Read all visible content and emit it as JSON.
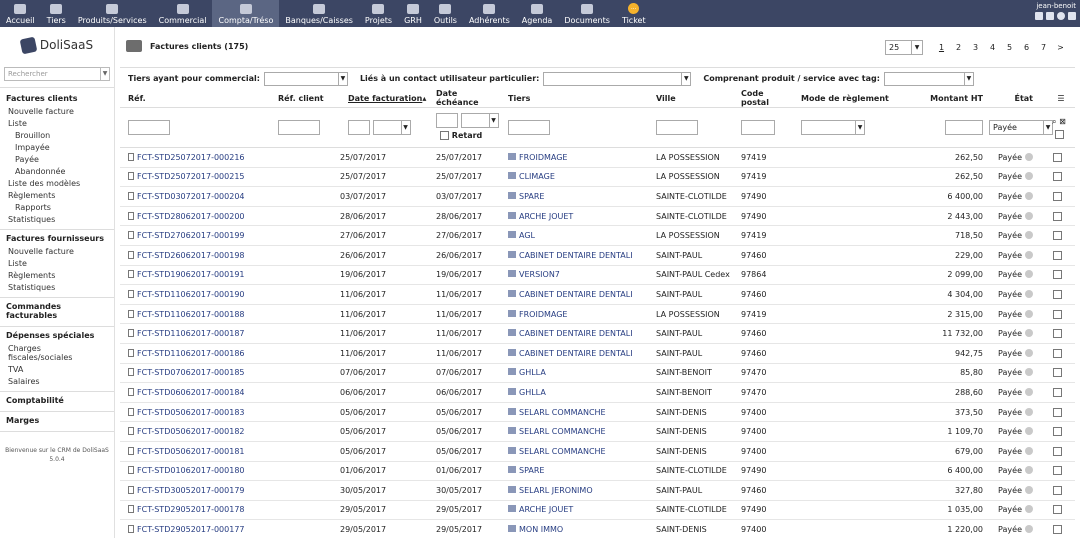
{
  "topnav": [
    {
      "label": "Accueil",
      "icon": "home-icon"
    },
    {
      "label": "Tiers",
      "icon": "company-icon"
    },
    {
      "label": "Produits/Services",
      "icon": "products-icon"
    },
    {
      "label": "Commercial",
      "icon": "commercial-icon"
    },
    {
      "label": "Compta/Tréso",
      "icon": "accounting-icon",
      "active": true
    },
    {
      "label": "Banques/Caisses",
      "icon": "bank-icon"
    },
    {
      "label": "Projets",
      "icon": "projects-icon"
    },
    {
      "label": "GRH",
      "icon": "hr-icon"
    },
    {
      "label": "Outils",
      "icon": "tools-icon"
    },
    {
      "label": "Adhérents",
      "icon": "members-icon"
    },
    {
      "label": "Agenda",
      "icon": "agenda-icon"
    },
    {
      "label": "Documents",
      "icon": "documents-icon"
    },
    {
      "label": "Ticket",
      "icon": "ticket-icon",
      "badge": "..."
    }
  ],
  "user": {
    "name": "jean-benoit"
  },
  "logo": {
    "text": "DoliSaaS"
  },
  "search": {
    "placeholder": "Rechercher"
  },
  "menu": [
    {
      "title": "Factures clients",
      "items": [
        {
          "label": "Nouvelle facture",
          "level": 1
        },
        {
          "label": "Liste",
          "level": 1
        },
        {
          "label": "Brouillon",
          "level": 2
        },
        {
          "label": "Impayée",
          "level": 2
        },
        {
          "label": "Payée",
          "level": 2
        },
        {
          "label": "Abandonnée",
          "level": 2
        },
        {
          "label": "Liste des modèles",
          "level": 1
        },
        {
          "label": "Règlements",
          "level": 1
        },
        {
          "label": "Rapports",
          "level": 2
        },
        {
          "label": "Statistiques",
          "level": 1
        }
      ]
    },
    {
      "title": "Factures fournisseurs",
      "items": [
        {
          "label": "Nouvelle facture",
          "level": 1
        },
        {
          "label": "Liste",
          "level": 1
        },
        {
          "label": "Règlements",
          "level": 1
        },
        {
          "label": "Statistiques",
          "level": 1
        }
      ]
    },
    {
      "title": "Commandes facturables",
      "items": []
    },
    {
      "title": "Dépenses spéciales",
      "items": [
        {
          "label": "Charges fiscales/sociales",
          "level": 1
        },
        {
          "label": "TVA",
          "level": 1
        },
        {
          "label": "Salaires",
          "level": 1
        }
      ]
    },
    {
      "title": "Comptabilité",
      "items": []
    },
    {
      "title": "Marges",
      "items": []
    }
  ],
  "footer": {
    "line1": "Bienvenue sur le CRM de DoliSaaS",
    "line2": "5.0.4"
  },
  "page": {
    "title": "Factures clients (175)"
  },
  "pager": {
    "per_page": "25",
    "pages": [
      "1",
      "2",
      "3",
      "4",
      "5",
      "6",
      "7"
    ],
    "next": ">",
    "current": "1"
  },
  "filters": {
    "commercial_label": "Tiers ayant pour commercial:",
    "contact_label": "Liés à un contact utilisateur particulier:",
    "tag_label": "Comprenant produit / service avec tag:",
    "retard_label": "Retard",
    "etat_value": "Payée"
  },
  "columns": {
    "ref": "Réf.",
    "ref_client": "Réf. client",
    "date_fact": "Date facturation",
    "date_ech": "Date échéance",
    "tiers": "Tiers",
    "ville": "Ville",
    "cp": "Code postal",
    "mode": "Mode de règlement",
    "montant": "Montant HT",
    "etat": "État"
  },
  "rows": [
    {
      "ref": "FCT-STD25072017-000216",
      "date": "25/07/2017",
      "due": "25/07/2017",
      "tiers": "FROIDMAGE",
      "ville": "LA POSSESSION",
      "cp": "97419",
      "montant": "262,50",
      "etat": "Payée"
    },
    {
      "ref": "FCT-STD25072017-000215",
      "date": "25/07/2017",
      "due": "25/07/2017",
      "tiers": "CLIMAGE",
      "ville": "LA POSSESSION",
      "cp": "97419",
      "montant": "262,50",
      "etat": "Payée"
    },
    {
      "ref": "FCT-STD03072017-000204",
      "date": "03/07/2017",
      "due": "03/07/2017",
      "tiers": "SPARE",
      "ville": "SAINTE-CLOTILDE",
      "cp": "97490",
      "montant": "6 400,00",
      "etat": "Payée"
    },
    {
      "ref": "FCT-STD28062017-000200",
      "date": "28/06/2017",
      "due": "28/06/2017",
      "tiers": "ARCHE JOUET",
      "ville": "SAINTE-CLOTILDE",
      "cp": "97490",
      "montant": "2 443,00",
      "etat": "Payée"
    },
    {
      "ref": "FCT-STD27062017-000199",
      "date": "27/06/2017",
      "due": "27/06/2017",
      "tiers": "AGL",
      "ville": "LA POSSESSION",
      "cp": "97419",
      "montant": "718,50",
      "etat": "Payée"
    },
    {
      "ref": "FCT-STD26062017-000198",
      "date": "26/06/2017",
      "due": "26/06/2017",
      "tiers": "CABINET DENTAIRE DENTALI",
      "ville": "SAINT-PAUL",
      "cp": "97460",
      "montant": "229,00",
      "etat": "Payée"
    },
    {
      "ref": "FCT-STD19062017-000191",
      "date": "19/06/2017",
      "due": "19/06/2017",
      "tiers": "VERSION7",
      "ville": "SAINT-PAUL Cedex",
      "cp": "97864",
      "montant": "2 099,00",
      "etat": "Payée"
    },
    {
      "ref": "FCT-STD11062017-000190",
      "date": "11/06/2017",
      "due": "11/06/2017",
      "tiers": "CABINET DENTAIRE DENTALI",
      "ville": "SAINT-PAUL",
      "cp": "97460",
      "montant": "4 304,00",
      "etat": "Payée"
    },
    {
      "ref": "FCT-STD11062017-000188",
      "date": "11/06/2017",
      "due": "11/06/2017",
      "tiers": "FROIDMAGE",
      "ville": "LA POSSESSION",
      "cp": "97419",
      "montant": "2 315,00",
      "etat": "Payée"
    },
    {
      "ref": "FCT-STD11062017-000187",
      "date": "11/06/2017",
      "due": "11/06/2017",
      "tiers": "CABINET DENTAIRE DENTALI",
      "ville": "SAINT-PAUL",
      "cp": "97460",
      "montant": "11 732,00",
      "etat": "Payée"
    },
    {
      "ref": "FCT-STD11062017-000186",
      "date": "11/06/2017",
      "due": "11/06/2017",
      "tiers": "CABINET DENTAIRE DENTALI",
      "ville": "SAINT-PAUL",
      "cp": "97460",
      "montant": "942,75",
      "etat": "Payée"
    },
    {
      "ref": "FCT-STD07062017-000185",
      "date": "07/06/2017",
      "due": "07/06/2017",
      "tiers": "GHLLA",
      "ville": "SAINT-BENOIT",
      "cp": "97470",
      "montant": "85,80",
      "etat": "Payée"
    },
    {
      "ref": "FCT-STD06062017-000184",
      "date": "06/06/2017",
      "due": "06/06/2017",
      "tiers": "GHLLA",
      "ville": "SAINT-BENOIT",
      "cp": "97470",
      "montant": "288,60",
      "etat": "Payée"
    },
    {
      "ref": "FCT-STD05062017-000183",
      "date": "05/06/2017",
      "due": "05/06/2017",
      "tiers": "SELARL COMMANCHE",
      "ville": "SAINT-DENIS",
      "cp": "97400",
      "montant": "373,50",
      "etat": "Payée"
    },
    {
      "ref": "FCT-STD05062017-000182",
      "date": "05/06/2017",
      "due": "05/06/2017",
      "tiers": "SELARL COMMANCHE",
      "ville": "SAINT-DENIS",
      "cp": "97400",
      "montant": "1 109,70",
      "etat": "Payée"
    },
    {
      "ref": "FCT-STD05062017-000181",
      "date": "05/06/2017",
      "due": "05/06/2017",
      "tiers": "SELARL COMMANCHE",
      "ville": "SAINT-DENIS",
      "cp": "97400",
      "montant": "679,00",
      "etat": "Payée"
    },
    {
      "ref": "FCT-STD01062017-000180",
      "date": "01/06/2017",
      "due": "01/06/2017",
      "tiers": "SPARE",
      "ville": "SAINTE-CLOTILDE",
      "cp": "97490",
      "montant": "6 400,00",
      "etat": "Payée"
    },
    {
      "ref": "FCT-STD30052017-000179",
      "date": "30/05/2017",
      "due": "30/05/2017",
      "tiers": "SELARL JERONIMO",
      "ville": "SAINT-PAUL",
      "cp": "97460",
      "montant": "327,80",
      "etat": "Payée"
    },
    {
      "ref": "FCT-STD29052017-000178",
      "date": "29/05/2017",
      "due": "29/05/2017",
      "tiers": "ARCHE JOUET",
      "ville": "SAINTE-CLOTILDE",
      "cp": "97490",
      "montant": "1 035,00",
      "etat": "Payée"
    },
    {
      "ref": "FCT-STD29052017-000177",
      "date": "29/05/2017",
      "due": "29/05/2017",
      "tiers": "MON IMMO",
      "ville": "SAINT-DENIS",
      "cp": "97400",
      "montant": "1 220,00",
      "etat": "Payée"
    }
  ],
  "colors": {
    "topbar": "#3c4664",
    "link": "#263c81",
    "accent_ticket": "#f5b22c"
  }
}
